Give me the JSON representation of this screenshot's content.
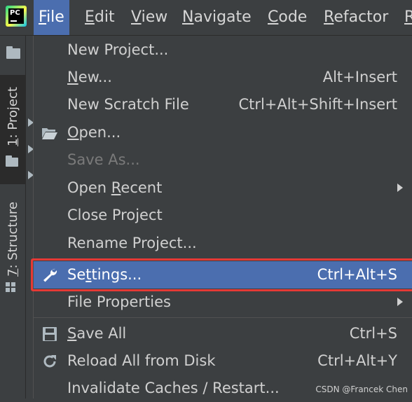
{
  "menubar": {
    "logo_text": "PC",
    "items": [
      {
        "pre": "",
        "mn": "F",
        "post": "ile"
      },
      {
        "pre": "",
        "mn": "E",
        "post": "dit"
      },
      {
        "pre": "",
        "mn": "V",
        "post": "iew"
      },
      {
        "pre": "",
        "mn": "N",
        "post": "avigate"
      },
      {
        "pre": "",
        "mn": "C",
        "post": "ode"
      },
      {
        "pre": "",
        "mn": "R",
        "post": "efactor"
      },
      {
        "pre": "",
        "mn": "R",
        "post": ""
      }
    ]
  },
  "left_strip": {
    "project_tab": {
      "mn": "1",
      "rest": ": Project"
    },
    "structure_tab": {
      "mn": "7",
      "rest": ": Structure"
    }
  },
  "file_menu": {
    "new_project": {
      "pre": "New Project...",
      "mn": "",
      "post": ""
    },
    "new": {
      "pre": "",
      "mn": "N",
      "post": "ew...",
      "shortcut": "Alt+Insert"
    },
    "new_scratch": {
      "pre": "New Scratch File",
      "mn": "",
      "post": "",
      "shortcut": "Ctrl+Alt+Shift+Insert"
    },
    "open": {
      "pre": "",
      "mn": "O",
      "post": "pen..."
    },
    "save_as": {
      "pre": "Save As...",
      "mn": "",
      "post": ""
    },
    "open_recent": {
      "pre": "Open ",
      "mn": "R",
      "post": "ecent"
    },
    "close_project": {
      "pre": "Close Project",
      "mn": "",
      "post": ""
    },
    "rename_project": {
      "pre": "Rename Project...",
      "mn": "",
      "post": ""
    },
    "settings": {
      "pre": "Se",
      "mn": "t",
      "post": "tings...",
      "shortcut": "Ctrl+Alt+S"
    },
    "file_properties": {
      "pre": "File Properties",
      "mn": "",
      "post": ""
    },
    "save_all": {
      "pre": "",
      "mn": "S",
      "post": "ave All",
      "shortcut": "Ctrl+S"
    },
    "reload": {
      "pre": "Reload All from Disk",
      "mn": "",
      "post": "",
      "shortcut": "Ctrl+Alt+Y"
    },
    "invalidate": {
      "pre": "Invalidate Caches / Restart...",
      "mn": "",
      "post": ""
    }
  },
  "watermark": "CSDN @Francek Chen",
  "colors": {
    "background": "#3c3f41",
    "selection": "#4b6eaf",
    "highlight_border": "#e53935",
    "text": "#d0d0d0",
    "disabled_text": "#7a7a7a"
  }
}
